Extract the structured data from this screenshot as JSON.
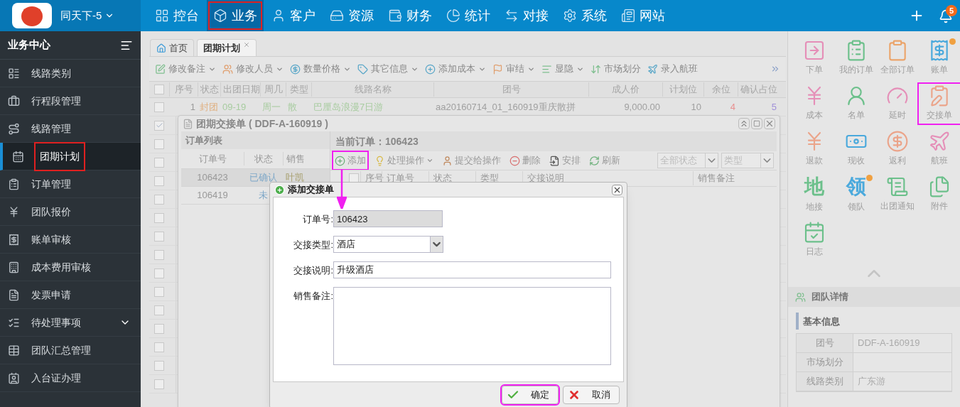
{
  "brand": {
    "name": "同天下-5"
  },
  "top_nav": [
    {
      "label": "控台",
      "selected": false,
      "highlighted": false
    },
    {
      "label": "业务",
      "selected": true,
      "highlighted": true
    },
    {
      "label": "客户",
      "selected": false,
      "highlighted": false
    },
    {
      "label": "资源",
      "selected": false,
      "highlighted": false
    },
    {
      "label": "财务",
      "selected": false,
      "highlighted": false
    },
    {
      "label": "统计",
      "selected": false,
      "highlighted": false
    },
    {
      "label": "对接",
      "selected": false,
      "highlighted": false
    },
    {
      "label": "系统",
      "selected": false,
      "highlighted": false
    },
    {
      "label": "网站",
      "selected": false,
      "highlighted": false
    }
  ],
  "notifications": {
    "badge": "5"
  },
  "sidebar": {
    "title": "业务中心",
    "items": [
      {
        "label": "线路类别",
        "selected": false,
        "highlighted": false,
        "has_submenu": false
      },
      {
        "label": "行程段管理",
        "selected": false,
        "highlighted": false,
        "has_submenu": false
      },
      {
        "label": "线路管理",
        "selected": false,
        "highlighted": false,
        "has_submenu": false
      },
      {
        "label": "团期计划",
        "selected": true,
        "highlighted": true,
        "has_submenu": false
      },
      {
        "label": "订单管理",
        "selected": false,
        "highlighted": false,
        "has_submenu": false
      },
      {
        "label": "团队报价",
        "selected": false,
        "highlighted": false,
        "has_submenu": false
      },
      {
        "label": "账单审核",
        "selected": false,
        "highlighted": false,
        "has_submenu": false
      },
      {
        "label": "成本费用审核",
        "selected": false,
        "highlighted": false,
        "has_submenu": false
      },
      {
        "label": "发票申请",
        "selected": false,
        "highlighted": false,
        "has_submenu": false
      },
      {
        "label": "待处理事项",
        "selected": false,
        "highlighted": false,
        "has_submenu": true
      },
      {
        "label": "团队汇总管理",
        "selected": false,
        "highlighted": false,
        "has_submenu": false
      },
      {
        "label": "入台证办理",
        "selected": false,
        "highlighted": false,
        "has_submenu": false
      }
    ]
  },
  "page_tabs": [
    {
      "label": "首页",
      "selected": false,
      "closable": false
    },
    {
      "label": "团期计划",
      "selected": true,
      "closable": true
    }
  ],
  "toolbar": [
    {
      "label": "修改备注",
      "dropdown": true
    },
    {
      "label": "修改人员",
      "dropdown": true
    },
    {
      "label": "数量价格",
      "dropdown": true
    },
    {
      "label": "其它信息",
      "dropdown": true
    },
    {
      "label": "添加成本",
      "dropdown": true
    },
    {
      "label": "审结",
      "dropdown": true
    },
    {
      "label": "显隐",
      "dropdown": true
    },
    {
      "label": "市场划分",
      "dropdown": false
    },
    {
      "label": "录入航班",
      "dropdown": false
    }
  ],
  "table": {
    "all_checked": false,
    "columns": [
      "序号",
      "状态",
      "出团日期",
      "周几",
      "类型",
      "线路名称",
      "团号",
      "成人价",
      "计划位",
      "余位",
      "确认占位"
    ],
    "rows": [
      {
        "checked": false,
        "cells": [
          "1",
          "封团",
          "09-19",
          "周一",
          "散",
          "巴厘岛浪漫7日游",
          "aa20160714_01_160919重庆散拼",
          "9,000.00",
          "10",
          "4",
          "5"
        ]
      },
      {
        "checked": true
      },
      {
        "checked": false
      },
      {
        "checked": false
      },
      {
        "checked": false
      },
      {
        "checked": false
      },
      {
        "checked": false
      },
      {
        "checked": false
      },
      {
        "checked": false
      },
      {
        "checked": false
      },
      {
        "checked": false
      },
      {
        "checked": false
      },
      {
        "checked": false
      },
      {
        "checked": false
      },
      {
        "checked": false
      },
      {
        "checked": false
      }
    ]
  },
  "handover_window": {
    "title": "团期交接单 ( DDF-A-160919 )",
    "order_list": {
      "title": "订单列表",
      "columns": [
        "订单号",
        "状态",
        "销售"
      ],
      "rows": [
        {
          "selected": true,
          "cells": [
            "106423",
            "已确认",
            "叶凯"
          ]
        },
        {
          "selected": false,
          "cells": [
            "106419",
            "未"
          ]
        }
      ]
    },
    "current_order": "当前订单：106423",
    "toolbar": [
      {
        "label": "添加",
        "dropdown": false,
        "highlighted": true
      },
      {
        "label": "处理操作",
        "dropdown": true,
        "highlighted": false
      },
      {
        "label": "提交给操作",
        "dropdown": false,
        "highlighted": false
      },
      {
        "label": "删除",
        "dropdown": false,
        "highlighted": false
      },
      {
        "label": "安排",
        "dropdown": false,
        "highlighted": false
      },
      {
        "label": "刷新",
        "dropdown": false,
        "highlighted": false
      }
    ],
    "filters": [
      {
        "placeholder": "全部状态"
      },
      {
        "placeholder": "类型"
      }
    ],
    "grid_all_checked": false,
    "grid_columns": [
      "序号",
      "订单号",
      "状态",
      "类型",
      "交接说明",
      "销售备注"
    ]
  },
  "add_dialog": {
    "title": "添加交接单",
    "fields": [
      {
        "kind": "text",
        "label": "订单号:",
        "value": "106423",
        "disabled": true
      },
      {
        "kind": "select",
        "label": "交接类型:",
        "value": "酒店"
      },
      {
        "kind": "text",
        "label": "交接说明:",
        "value": "升级酒店",
        "disabled": false
      },
      {
        "kind": "textarea",
        "label": "销售备注:"
      }
    ],
    "buttons": [
      {
        "kind": "confirm",
        "label": "确定",
        "highlighted": true
      },
      {
        "kind": "cancel",
        "label": "取消",
        "highlighted": false
      }
    ]
  },
  "quick_actions": [
    {
      "label": "下单",
      "color": "#e58fb8",
      "highlighted": false,
      "badge": false
    },
    {
      "label": "我的订单",
      "color": "#6cc08b",
      "highlighted": false,
      "badge": false
    },
    {
      "label": "全部订单",
      "color": "#eba46a",
      "highlighted": false,
      "badge": false
    },
    {
      "label": "账单",
      "color": "#4aa9dc",
      "highlighted": false,
      "badge": true
    },
    {
      "label": "成本",
      "color": "#e58fb8",
      "highlighted": false,
      "badge": false
    },
    {
      "label": "名单",
      "color": "#6cc08b",
      "highlighted": false,
      "badge": false
    },
    {
      "label": "延时",
      "color": "#e58fb8",
      "highlighted": false,
      "badge": false
    },
    {
      "label": "交接单",
      "color": "#eba48a",
      "highlighted": true,
      "badge": false
    },
    {
      "label": "退款",
      "color": "#eba48a",
      "highlighted": false,
      "badge": false
    },
    {
      "label": "现收",
      "color": "#4aa9dc",
      "highlighted": false,
      "badge": false
    },
    {
      "label": "返利",
      "color": "#eba48a",
      "highlighted": false,
      "badge": false
    },
    {
      "label": "航班",
      "color": "#e58fb8",
      "highlighted": false,
      "badge": false
    },
    {
      "label": "地接",
      "color": "#6cc08b",
      "highlighted": false,
      "badge": false,
      "glyph": "地"
    },
    {
      "label": "领队",
      "color": "#4aa9dc",
      "highlighted": false,
      "badge": true,
      "glyph": "领"
    },
    {
      "label": "出团通知",
      "color": "#6cc08b",
      "highlighted": false,
      "badge": false
    },
    {
      "label": "附件",
      "color": "#6cc08b",
      "highlighted": false,
      "badge": false
    },
    {
      "label": "日志",
      "color": "#6cc08b",
      "highlighted": false,
      "badge": false
    }
  ],
  "team_details": {
    "title": "团队详情",
    "section": "基本信息",
    "rows": [
      {
        "label": "团号",
        "value": "DDF-A-160919"
      },
      {
        "label": "市场划分"
      },
      {
        "label": "线路类别",
        "value": "广东游"
      }
    ]
  }
}
